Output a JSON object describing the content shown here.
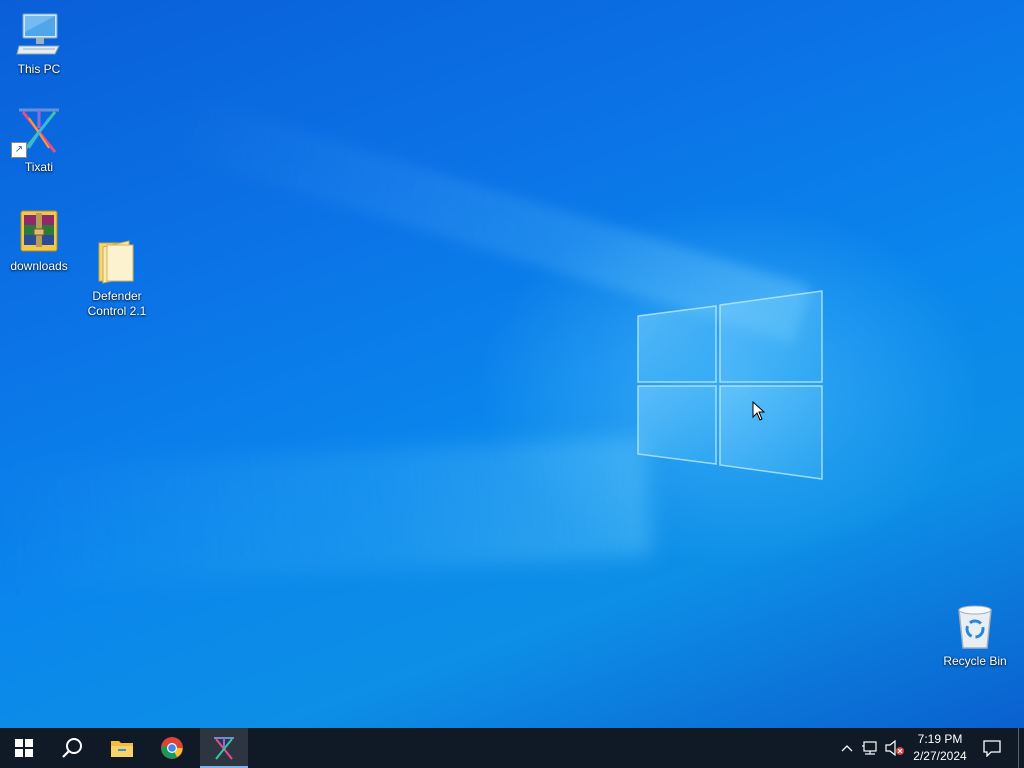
{
  "desktop": {
    "icons": [
      {
        "label": "This PC",
        "icon": "computer-icon"
      },
      {
        "label": "Tixati",
        "icon": "tixati-icon"
      },
      {
        "label": "downloads",
        "icon": "winrar-archive-icon"
      },
      {
        "label": "Defender\nControl 2.1",
        "icon": "folder-icon"
      },
      {
        "label": "Recycle Bin",
        "icon": "recycle-bin-icon"
      }
    ],
    "wallpaper": {
      "accent": "#0b78e8",
      "logo_color": "#7fd4ff"
    }
  },
  "taskbar": {
    "background": "#101a26",
    "pinned": [
      {
        "name": "Start",
        "icon": "windows-start-icon"
      },
      {
        "name": "Search",
        "icon": "search-icon"
      },
      {
        "name": "File Explorer",
        "icon": "file-explorer-icon"
      },
      {
        "name": "Google Chrome",
        "icon": "chrome-icon"
      },
      {
        "name": "Tixati",
        "icon": "tixati-icon",
        "active": true
      }
    ],
    "tray": {
      "icons": [
        "chevron-up-icon",
        "network-icon",
        "volume-muted-icon"
      ],
      "time": "7:19 PM",
      "date": "2/27/2024",
      "notification_icon": "action-center-icon"
    }
  }
}
